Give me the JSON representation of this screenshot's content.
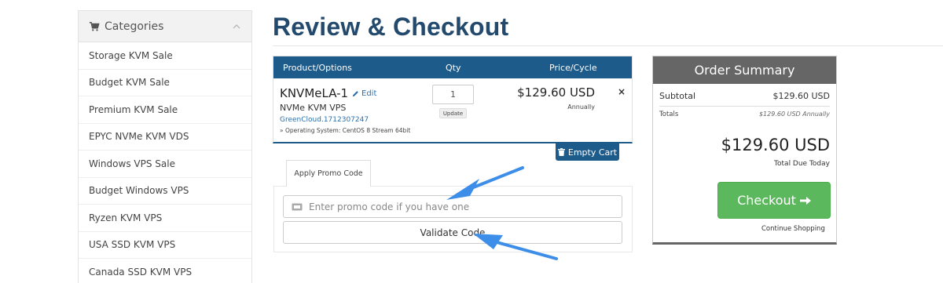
{
  "sidebar": {
    "title": "Categories",
    "items": [
      {
        "label": "Storage KVM Sale"
      },
      {
        "label": "Budget KVM Sale"
      },
      {
        "label": "Premium KVM Sale"
      },
      {
        "label": "EPYC NVMe KVM VDS"
      },
      {
        "label": "Windows VPS Sale"
      },
      {
        "label": "Budget Windows VPS"
      },
      {
        "label": "Ryzen KVM VPS"
      },
      {
        "label": "USA SSD KVM VPS"
      },
      {
        "label": "Canada SSD KVM VPS"
      }
    ]
  },
  "page": {
    "title": "Review & Checkout"
  },
  "cart": {
    "headers": {
      "product": "Product/Options",
      "qty": "Qty",
      "price": "Price/Cycle"
    },
    "item": {
      "name": "KNVMeLA-1",
      "edit_label": "Edit",
      "product": "NVMe KVM VPS",
      "domain": "GreenCloud.1712307247",
      "os": "» Operating System: CentOS 8 Stream 64bit",
      "qty": "1",
      "update_label": "Update",
      "price": "$129.60 USD",
      "cycle": "Annually",
      "remove": "×"
    },
    "empty_cart_label": "Empty Cart"
  },
  "promo": {
    "tab_label": "Apply Promo Code",
    "placeholder": "Enter promo code if you have one",
    "validate_label": "Validate Code"
  },
  "summary": {
    "title": "Order Summary",
    "subtotal_label": "Subtotal",
    "subtotal_value": "$129.60 USD",
    "totals_label": "Totals",
    "totals_value": "$129.60 USD Annually",
    "total_due": "$129.60 USD",
    "total_due_label": "Total Due Today",
    "checkout_label": "Checkout",
    "continue_label": "Continue Shopping"
  },
  "colors": {
    "primary": "#1d5b8b",
    "title": "#234a6d",
    "checkout": "#5cb85c",
    "summary_header": "#666666",
    "annotation_arrow": "#3d8ee8"
  }
}
